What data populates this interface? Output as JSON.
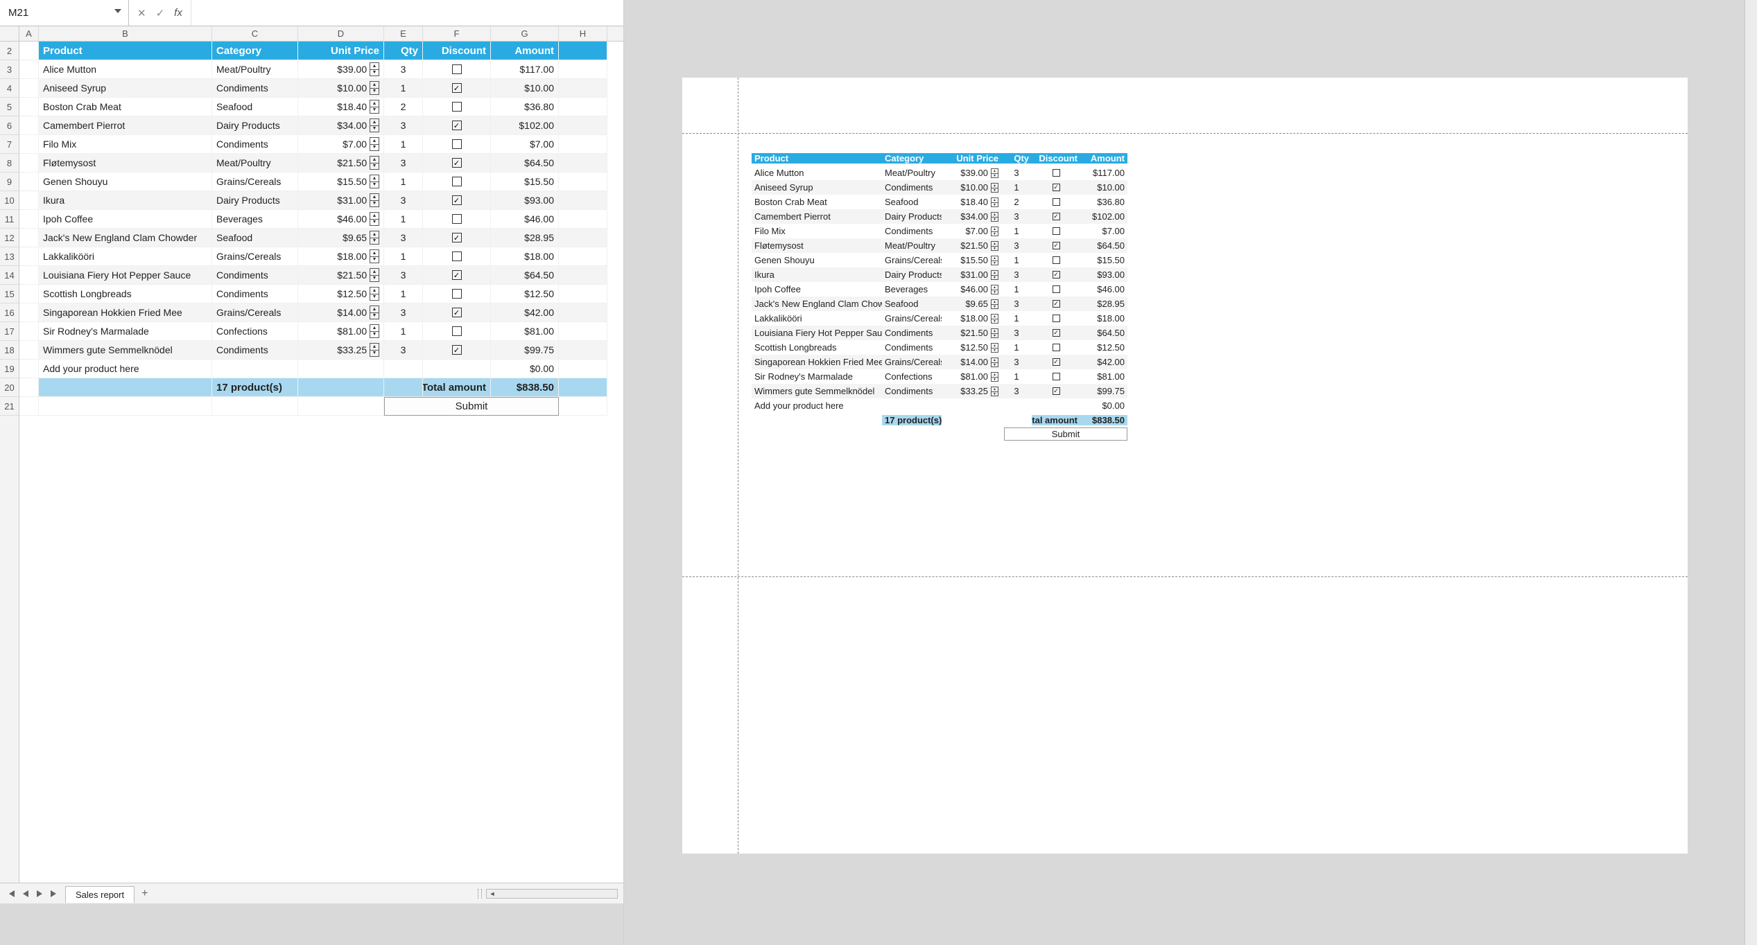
{
  "namebox": "M21",
  "formula_value": "",
  "col_letters": [
    "A",
    "B",
    "C",
    "D",
    "E",
    "F",
    "G",
    "H"
  ],
  "row_nums": [
    2,
    3,
    4,
    5,
    6,
    7,
    8,
    9,
    10,
    11,
    12,
    13,
    14,
    15,
    16,
    17,
    18,
    19,
    20,
    21
  ],
  "headers": {
    "product": "Product",
    "category": "Category",
    "unit_price": "Unit Price",
    "qty": "Qty",
    "discount": "Discount",
    "amount": "Amount"
  },
  "rows": [
    {
      "product": "Alice Mutton",
      "category": "Meat/Poultry",
      "price": "$39.00",
      "qty": "3",
      "disc": false,
      "amount": "$117.00"
    },
    {
      "product": "Aniseed Syrup",
      "category": "Condiments",
      "price": "$10.00",
      "qty": "1",
      "disc": true,
      "amount": "$10.00"
    },
    {
      "product": "Boston Crab Meat",
      "category": "Seafood",
      "price": "$18.40",
      "qty": "2",
      "disc": false,
      "amount": "$36.80"
    },
    {
      "product": "Camembert Pierrot",
      "category": "Dairy Products",
      "price": "$34.00",
      "qty": "3",
      "disc": true,
      "amount": "$102.00"
    },
    {
      "product": "Filo Mix",
      "category": "Condiments",
      "price": "$7.00",
      "qty": "1",
      "disc": false,
      "amount": "$7.00"
    },
    {
      "product": "Fløtemysost",
      "category": "Meat/Poultry",
      "price": "$21.50",
      "qty": "3",
      "disc": true,
      "amount": "$64.50"
    },
    {
      "product": "Genen Shouyu",
      "category": "Grains/Cereals",
      "price": "$15.50",
      "qty": "1",
      "disc": false,
      "amount": "$15.50"
    },
    {
      "product": "Ikura",
      "category": "Dairy Products",
      "price": "$31.00",
      "qty": "3",
      "disc": true,
      "amount": "$93.00"
    },
    {
      "product": "Ipoh Coffee",
      "category": "Beverages",
      "price": "$46.00",
      "qty": "1",
      "disc": false,
      "amount": "$46.00"
    },
    {
      "product": "Jack's New England Clam Chowder",
      "category": "Seafood",
      "price": "$9.65",
      "qty": "3",
      "disc": true,
      "amount": "$28.95"
    },
    {
      "product": "Lakkalikööri",
      "category": "Grains/Cereals",
      "price": "$18.00",
      "qty": "1",
      "disc": false,
      "amount": "$18.00"
    },
    {
      "product": "Louisiana Fiery Hot Pepper Sauce",
      "category": "Condiments",
      "price": "$21.50",
      "qty": "3",
      "disc": true,
      "amount": "$64.50"
    },
    {
      "product": "Scottish Longbreads",
      "category": "Condiments",
      "price": "$12.50",
      "qty": "1",
      "disc": false,
      "amount": "$12.50"
    },
    {
      "product": "Singaporean Hokkien Fried Mee",
      "category": "Grains/Cereals",
      "price": "$14.00",
      "qty": "3",
      "disc": true,
      "amount": "$42.00"
    },
    {
      "product": "Sir Rodney's Marmalade",
      "category": "Confections",
      "price": "$81.00",
      "qty": "1",
      "disc": false,
      "amount": "$81.00"
    },
    {
      "product": "Wimmers gute Semmelknödel",
      "category": "Condiments",
      "price": "$33.25",
      "qty": "3",
      "disc": true,
      "amount": "$99.75"
    }
  ],
  "add_row_text": "Add your product here",
  "add_row_amount": "$0.00",
  "totals": {
    "count_label": "17 product(s)",
    "total_label": "Total amount",
    "total_value": "$838.50"
  },
  "submit_label": "Submit",
  "sheet_tab": "Sales report"
}
